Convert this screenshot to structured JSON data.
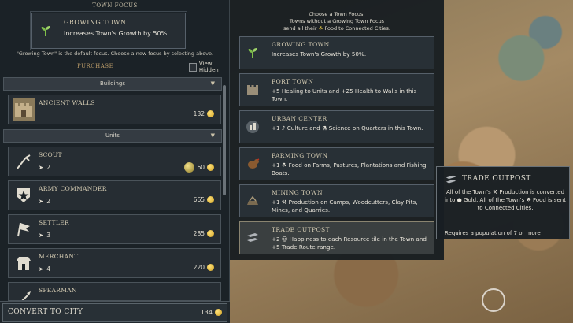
{
  "town_focus": {
    "title": "TOWN FOCUS",
    "current": {
      "name": "GROWING TOWN",
      "desc": "Increases Town's Growth by 50%.",
      "icon": "sprout-icon"
    },
    "default_note": "\"Growing Town\" is the default focus. Choose a new focus by selecting above."
  },
  "purchase": {
    "label": "PURCHASE",
    "view_hidden": "View Hidden",
    "buildings_header": "Buildings",
    "units_header": "Units",
    "buildings": [
      {
        "name": "ANCIENT WALLS",
        "cost": "132",
        "icon": "walls-icon"
      }
    ],
    "units": [
      {
        "name": "SCOUT",
        "moves": "2",
        "cost": "60",
        "extra": "resource-icon",
        "icon": "scout-icon"
      },
      {
        "name": "ARMY COMMANDER",
        "moves": "2",
        "cost": "665",
        "icon": "commander-icon"
      },
      {
        "name": "SETTLER",
        "moves": "3",
        "cost": "285",
        "icon": "flag-icon"
      },
      {
        "name": "MERCHANT",
        "moves": "4",
        "cost": "220",
        "icon": "merchant-icon"
      },
      {
        "name": "SPEARMAN",
        "icon": "spear-icon"
      }
    ]
  },
  "convert": {
    "label": "CONVERT TO CITY",
    "cost": "134"
  },
  "choose": {
    "line1": "Choose a Town Focus:",
    "line2": "Towns without a Growing Town Focus",
    "line3": "send all their",
    "line3b": "Food to Connected Cities.",
    "options": [
      {
        "name": "GROWING TOWN",
        "desc": "Increases Town's Growth by 50%.",
        "icon": "sprout-icon"
      },
      {
        "name": "FORT TOWN",
        "desc": "+5 Healing to Units and +25 Health to Walls in this Town.",
        "icon": "fort-icon"
      },
      {
        "name": "URBAN CENTER",
        "desc": "+1 ♪ Culture and ⚗ Science on Quarters in this Town.",
        "icon": "urban-icon"
      },
      {
        "name": "FARMING TOWN",
        "desc": "+1 ☘ Food on Farms, Pastures, Plantations and Fishing Boats.",
        "icon": "farm-icon"
      },
      {
        "name": "MINING TOWN",
        "desc": "+1 ⚒ Production on Camps, Woodcutters, Clay Pits, Mines, and Quarries.",
        "icon": "mining-icon"
      },
      {
        "name": "TRADE OUTPOST",
        "desc": "+2 ☺ Happiness to each Resource tile in the Town and +5 Trade Route range.",
        "icon": "trade-icon"
      }
    ]
  },
  "tooltip": {
    "title": "TRADE OUTPOST",
    "body": "All of the Town's ⚒ Production is converted into ● Gold. All of the Town's ☘ Food is sent to Connected Cities.",
    "requirement": "Requires a population of 7 or more"
  }
}
